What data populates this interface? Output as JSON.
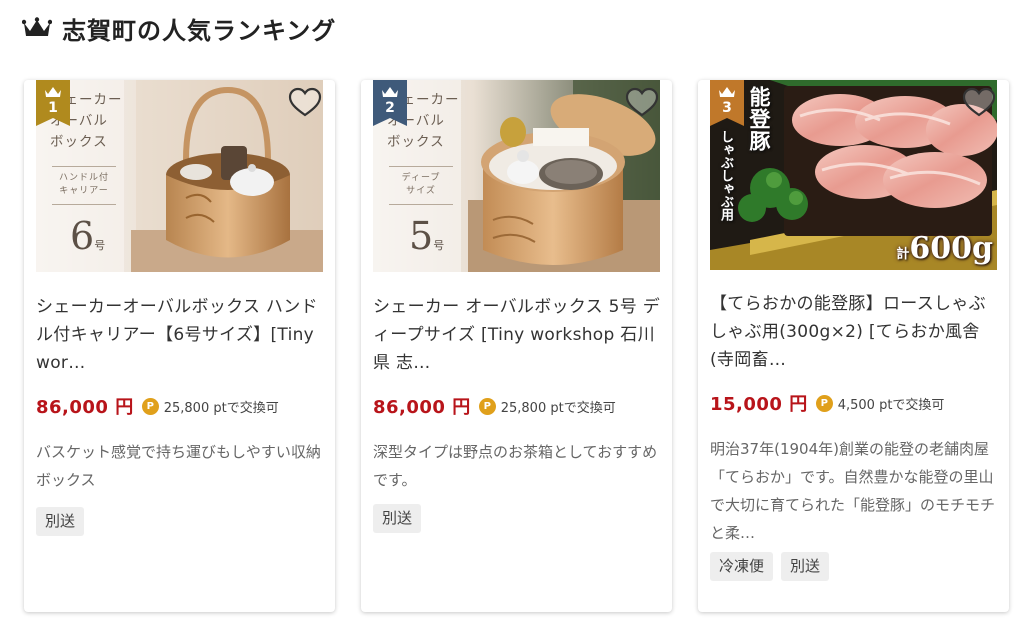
{
  "header": {
    "title": "志賀町の人気ランキング",
    "icon": "crown-icon"
  },
  "colors": {
    "gold": "#b08a1e",
    "navy": "#3f5a7a",
    "bronze": "#c0782a",
    "price": "#b8141a",
    "point": "#e0a01b",
    "tag_bg": "#eeeeee"
  },
  "cards": [
    {
      "rank": "1",
      "image_overlay": {
        "title_line1": "シェーカー",
        "title_line2": "オーバル",
        "title_line3": "ボックス",
        "sub_line1": "ハンドル付",
        "sub_line2": "キャリアー",
        "size": "6",
        "size_unit": "号"
      },
      "title": "シェーカーオーバルボックス ハンドル付キャリアー【6号サイズ】[Tiny wor…",
      "price": "86,000 円",
      "points": "25,800 ptで交換可",
      "description": "バスケット感覚で持ち運びもしやすい収納ボックス",
      "tags": [
        "別送"
      ]
    },
    {
      "rank": "2",
      "image_overlay": {
        "title_line1": "シェーカー",
        "title_line2": "オーバル",
        "title_line3": "ボックス",
        "sub_line1": "ディープ",
        "sub_line2": "サイズ",
        "size": "5",
        "size_unit": "号"
      },
      "title": "シェーカー オーバルボックス 5号 ディープサイズ [Tiny workshop 石川県 志…",
      "price": "86,000 円",
      "points": "25,800 ptで交換可",
      "description": "深型タイプは野点のお茶箱としておすすめです。",
      "tags": [
        "別送"
      ]
    },
    {
      "rank": "3",
      "image_overlay": {
        "vertical_main": "能登豚",
        "vertical_sub": "しゃぶしゃぶ用",
        "weight_prefix": "計",
        "weight": "600g"
      },
      "title": "【てらおかの能登豚】ロースしゃぶしゃぶ用(300g×2) [てらおか風舎(寺岡畜…",
      "price": "15,000 円",
      "points": "4,500 ptで交換可",
      "description": "明治37年(1904年)創業の能登の老舗肉屋「てらおか」です。自然豊かな能登の里山で大切に育てられた「能登豚」のモチモチと柔…",
      "tags": [
        "冷凍便",
        "別送"
      ]
    }
  ]
}
